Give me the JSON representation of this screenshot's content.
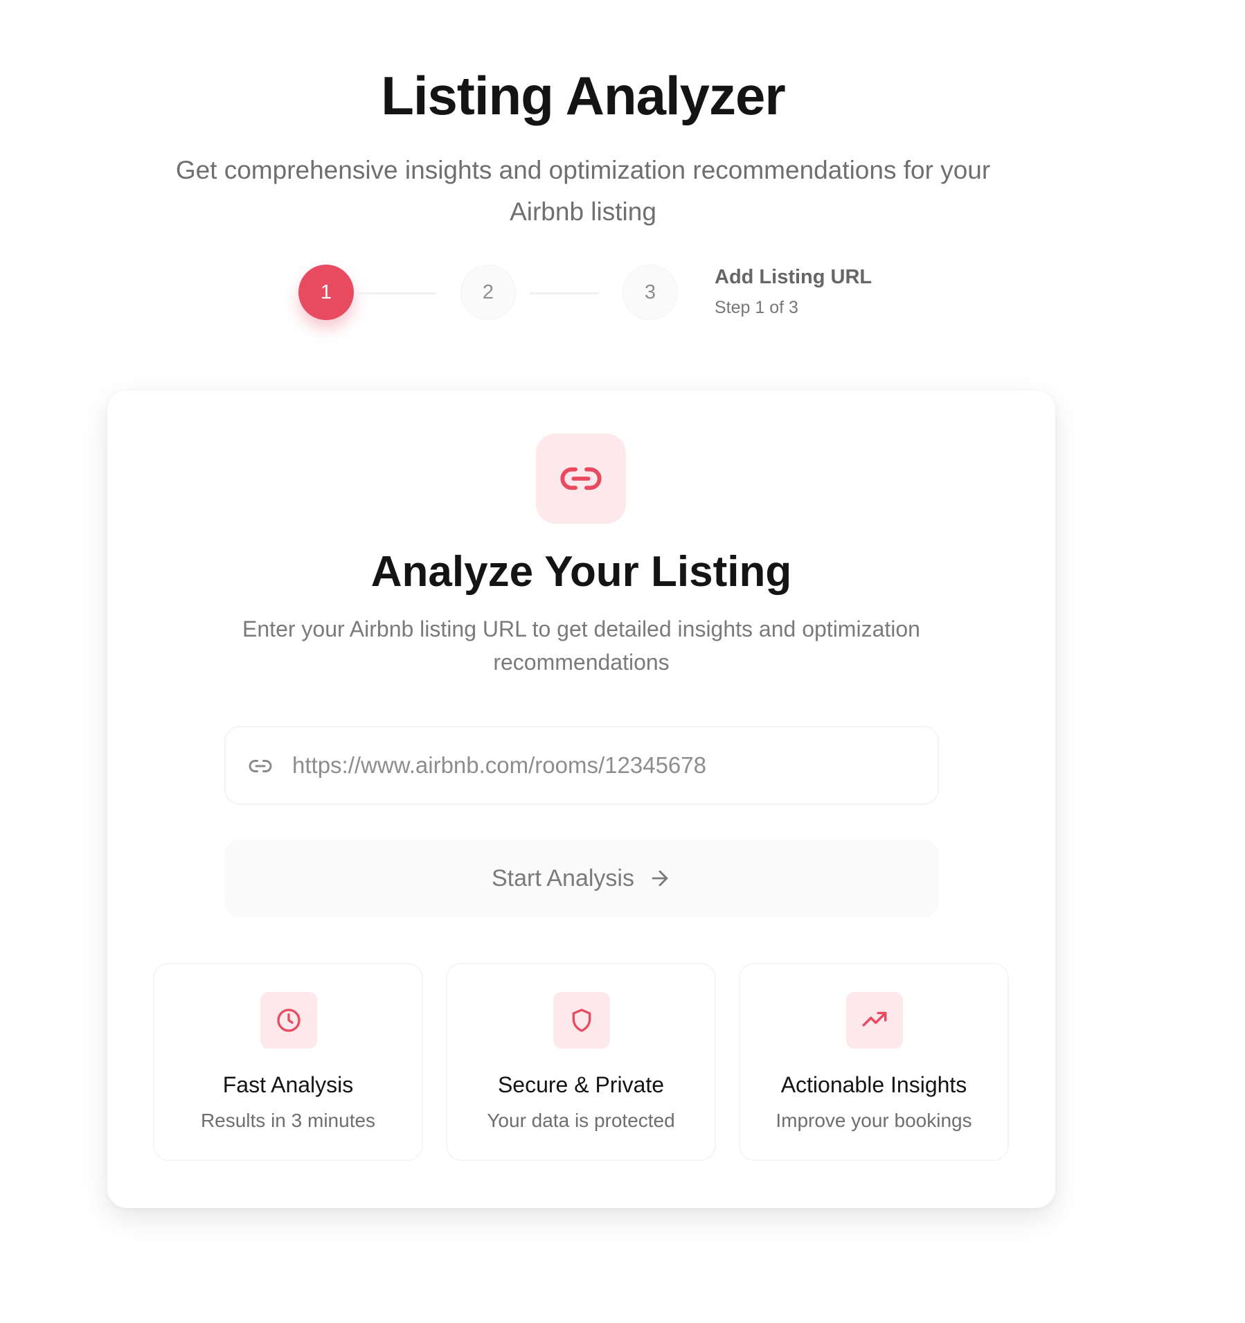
{
  "header": {
    "title": "Listing Analyzer",
    "subtitle": "Get comprehensive insights and optimization recommendations for your Airbnb listing"
  },
  "stepper": {
    "steps": [
      {
        "number": "1",
        "state": "active"
      },
      {
        "number": "2",
        "state": "inactive"
      },
      {
        "number": "3",
        "state": "inactive"
      }
    ],
    "current_label": "Add Listing URL",
    "current_count": "Step 1 of 3"
  },
  "card": {
    "hero_icon": "link-icon",
    "title": "Analyze Your Listing",
    "description": "Enter your Airbnb listing URL to get detailed insights and optimization recommendations",
    "url_field": {
      "icon": "link-icon",
      "value": "",
      "placeholder": "https://www.airbnb.com/rooms/12345678"
    },
    "start_button": {
      "label": "Start Analysis",
      "icon": "arrow-right-icon"
    },
    "features": [
      {
        "icon": "clock-icon",
        "title": "Fast Analysis",
        "subtitle": "Results in 3 minutes"
      },
      {
        "icon": "shield-icon",
        "title": "Secure & Private",
        "subtitle": "Your data is protected"
      },
      {
        "icon": "trending-up-icon",
        "title": "Actionable Insights",
        "subtitle": "Improve your bookings"
      }
    ]
  },
  "colors": {
    "accent": "#e84a5f",
    "accent_light": "#fde9ec",
    "text_primary": "#141414",
    "text_muted": "#7a7a7a"
  }
}
